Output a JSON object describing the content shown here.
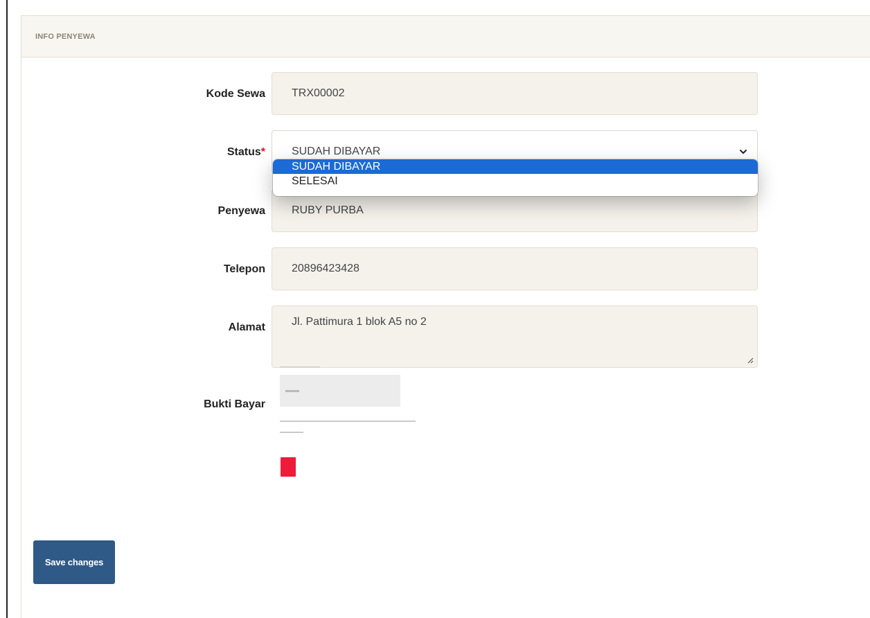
{
  "card": {
    "title": "INFO PENYEWA"
  },
  "form": {
    "kode_sewa": {
      "label": "Kode Sewa",
      "value": "TRX00002"
    },
    "status": {
      "label": "Status",
      "required_mark": "*",
      "value": "SUDAH DIBAYAR",
      "options": [
        "SUDAH DIBAYAR",
        "SELESAI"
      ],
      "selected_index": 0
    },
    "penyewa": {
      "label": "Penyewa",
      "value": "RUBY PURBA"
    },
    "telepon": {
      "label": "Telepon",
      "value": "20896423428"
    },
    "alamat": {
      "label": "Alamat",
      "value": "Jl. Pattimura 1 blok A5 no 2"
    },
    "bukti_bayar": {
      "label": "Bukti Bayar"
    }
  },
  "actions": {
    "save_label": "Save changes"
  },
  "colors": {
    "accent": "#1b6ad6",
    "save_button": "#2f5987",
    "required": "#e0101c",
    "proof_button": "#ee1c3a",
    "field_background": "#f5f2ec"
  }
}
